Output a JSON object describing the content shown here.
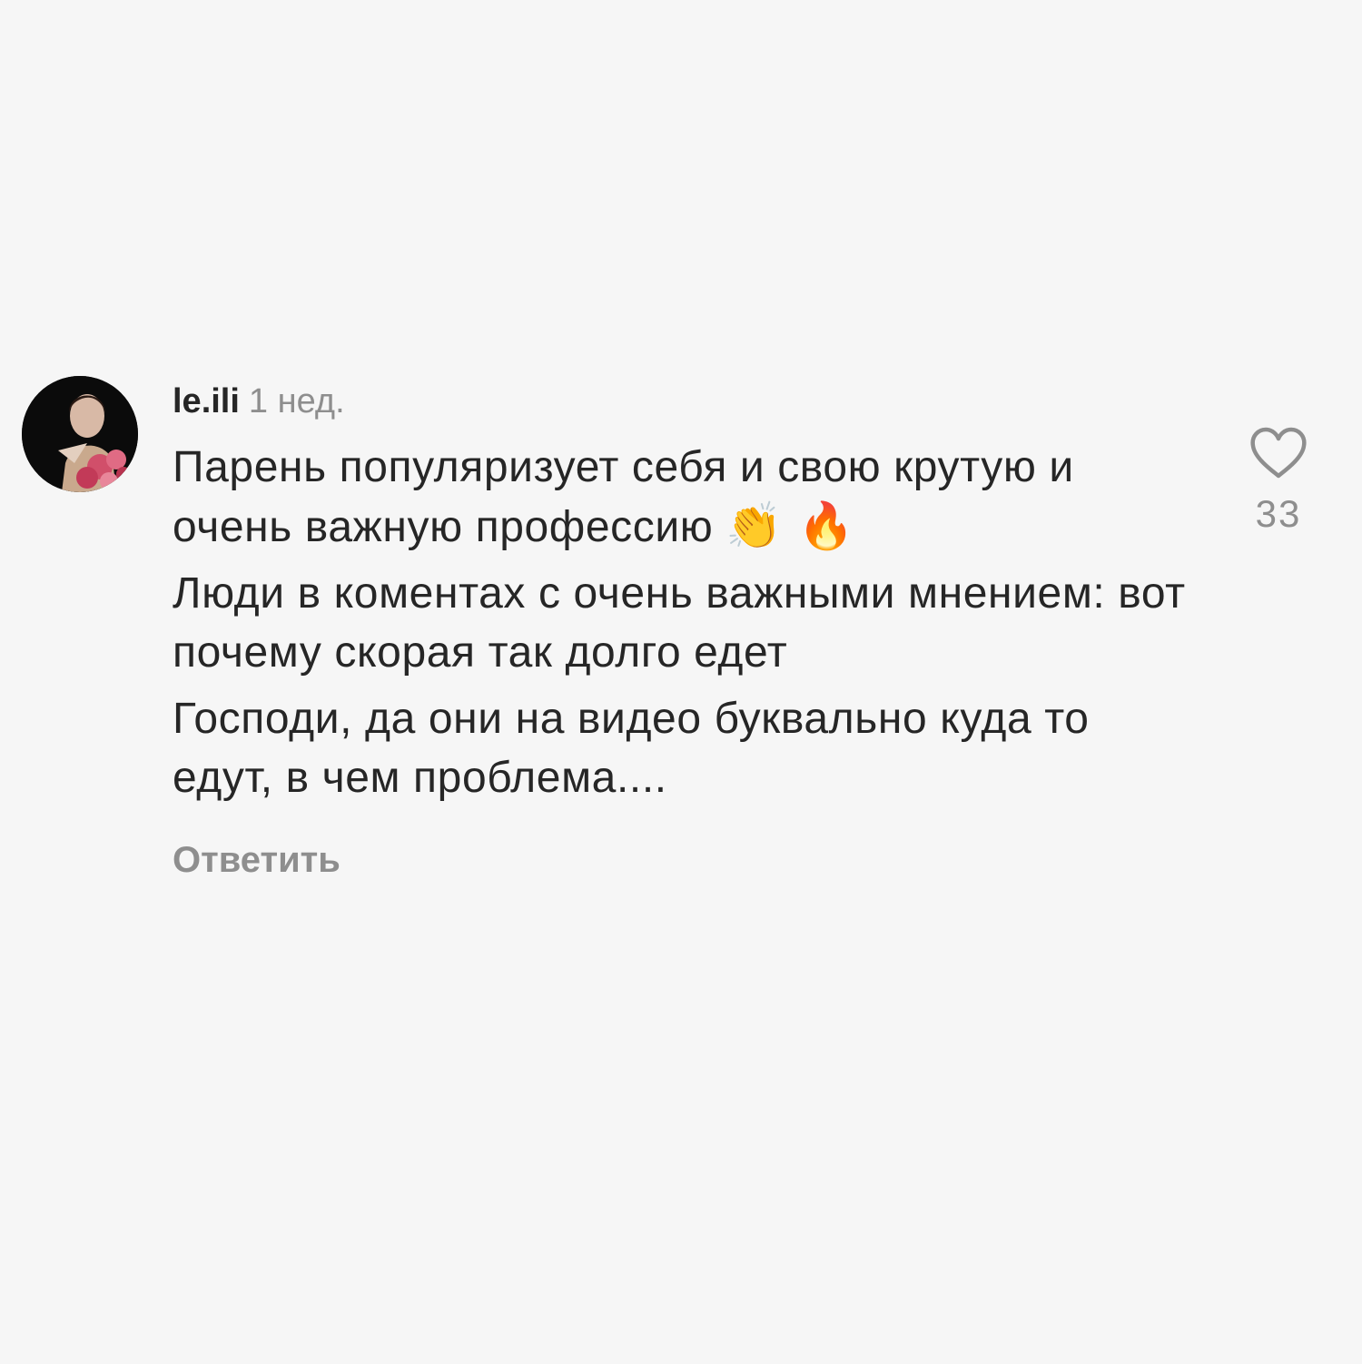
{
  "comment": {
    "username": "le.ili",
    "time": "1 нед.",
    "paragraphs": [
      {
        "text": "Парень популяризует себя и свою крутую и очень важную профессию",
        "emojis": "👏 🔥"
      },
      {
        "text": "Люди в коментах с очень важными мнением: вот почему скорая так долго едет"
      },
      {
        "text": "Господи, да они на видео буквально куда то едут, в чем проблема...."
      }
    ],
    "reply_label": "Ответить",
    "like_count": "33",
    "icons": {
      "avatar": "user-avatar",
      "like": "heart-outline-icon"
    }
  },
  "colors": {
    "background": "#f6f6f6",
    "text": "#262626",
    "secondary": "#8e8e8e"
  }
}
